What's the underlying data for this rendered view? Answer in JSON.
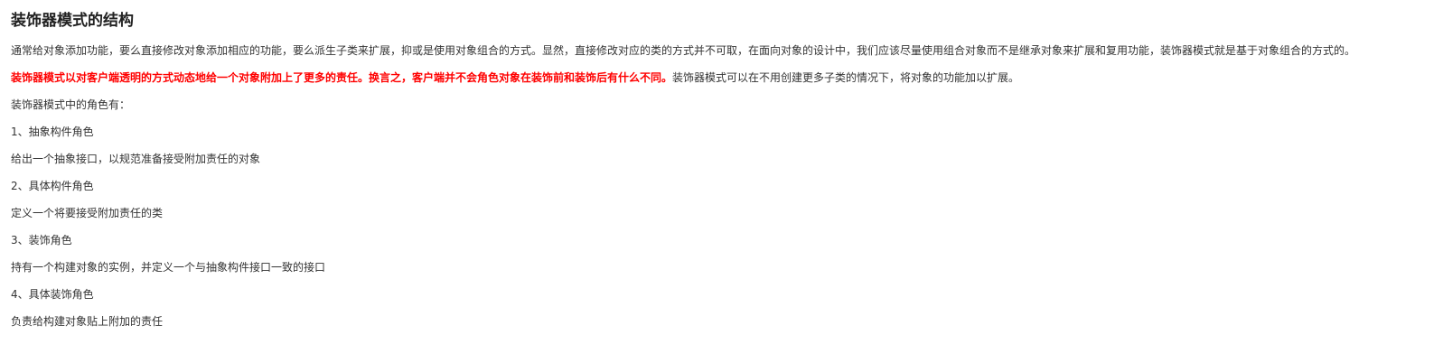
{
  "article": {
    "title": "装饰器模式的结构",
    "intro": "通常给对象添加功能，要么直接修改对象添加相应的功能，要么派生子类来扩展，抑或是使用对象组合的方式。显然，直接修改对应的类的方式并不可取，在面向对象的设计中，我们应该尽量使用组合对象而不是继承对象来扩展和复用功能，装饰器模式就是基于对象组合的方式的。",
    "definition_highlight": "装饰器模式以对客户端透明的方式动态地给一个对象附加上了更多的责任。换言之，客户端并不会角色对象在装饰前和装饰后有什么不同。",
    "definition_rest": "装饰器模式可以在不用创建更多子类的情况下，将对象的功能加以扩展。",
    "roles_heading": "装饰器模式中的角色有：",
    "roles": [
      {
        "name": "1、抽象构件角色",
        "desc": "给出一个抽象接口，以规范准备接受附加责任的对象"
      },
      {
        "name": "2、具体构件角色",
        "desc": "定义一个将要接受附加责任的类"
      },
      {
        "name": "3、装饰角色",
        "desc": "持有一个构建对象的实例，并定义一个与抽象构件接口一致的接口"
      },
      {
        "name": "4、具体装饰角色",
        "desc": "负责给构建对象贴上附加的责任"
      }
    ],
    "colors": {
      "text": "#333333",
      "highlight": "#ff0000"
    }
  }
}
